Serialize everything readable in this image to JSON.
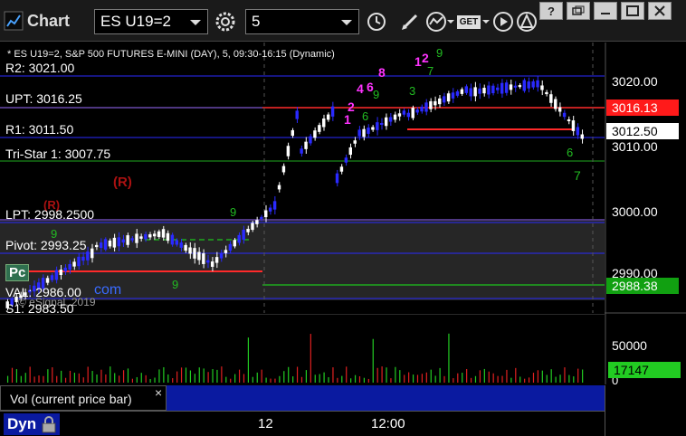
{
  "window": {
    "title": "Chart",
    "symbol": "ES U19=2",
    "interval": "5",
    "get_label": "GET"
  },
  "chart": {
    "description": "* ES U19=2, S&P 500 FUTURES E-MINI (DAY), 5, 09:30-16:15 (Dynamic)",
    "watermark": "© eSignal, 2019",
    "r_marker": "(R)",
    "levels": {
      "r2": "R2: 3021.00",
      "upt": "UPT: 3016.25",
      "r1": "R1: 3011.50",
      "tristar": "Tri-Star 1: 3007.75",
      "lpt": "LPT: 2998.25",
      "lpt_suffix": "00",
      "pivot": "Pivot: 2993.25",
      "val": "VAL: 2986.00",
      "s1": "S1: 2983.50"
    },
    "partial_labels": {
      "pc": "Pc",
      "com": "com",
      "y2019": "2019"
    },
    "y_ticks": [
      "3020.00",
      "3010.00",
      "3000.00",
      "2990.00"
    ],
    "price_tags": [
      {
        "value": "3016.13",
        "bg": "#ff1a1a",
        "fg": "#ffffff"
      },
      {
        "value": "3012.50",
        "bg": "#ffffff",
        "fg": "#000000"
      },
      {
        "value": "2988.38",
        "bg": "#11a011",
        "fg": "#ffffff"
      }
    ],
    "x_ticks": [
      "12",
      "12:00"
    ],
    "td_count_green": "7"
  },
  "volume": {
    "label": "Vol (current price bar)",
    "close_glyph": "×",
    "y_ticks": [
      "50000",
      "0"
    ],
    "current_tag": "17147",
    "current_bg": "#22cc22"
  },
  "footer": {
    "dyn_label": "Dyn"
  },
  "colors": {
    "up_candle": "#ffffff",
    "down_candle": "#2a2aff",
    "vol_up": "#22cc22",
    "vol_down": "#e02020",
    "magenta": "#ff33ff",
    "green_text": "#22bb22"
  }
}
